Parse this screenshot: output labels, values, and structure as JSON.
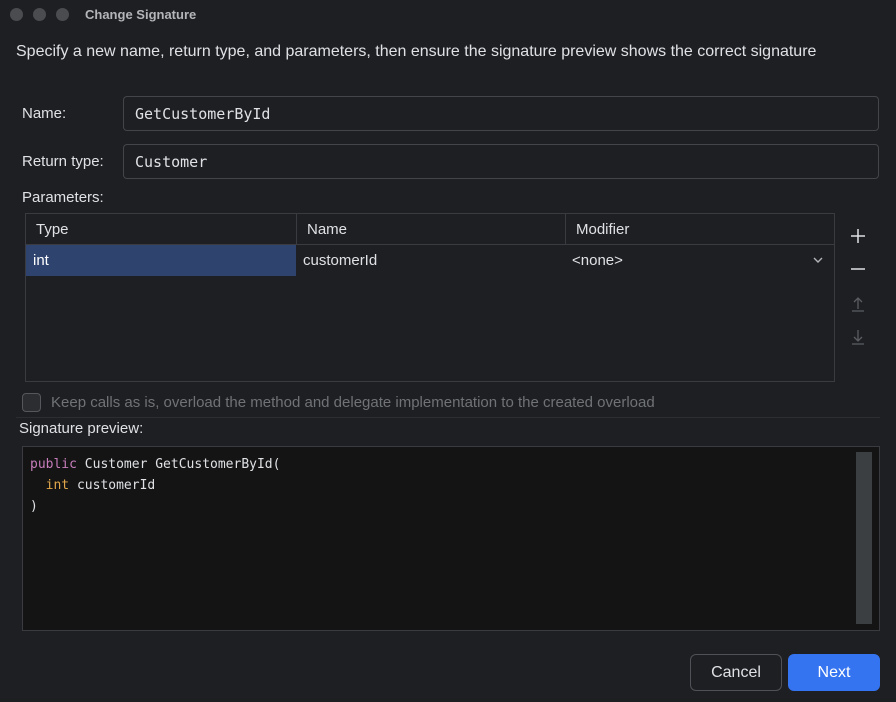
{
  "window": {
    "title": "Change Signature"
  },
  "instruction": "Specify a new name, return type, and parameters, then ensure the signature preview shows the correct signature",
  "form": {
    "name_label": "Name:",
    "name_value": "GetCustomerById",
    "return_type_label": "Return type:",
    "return_type_value": "Customer",
    "parameters_label": "Parameters:"
  },
  "parameters_table": {
    "columns": [
      "Type",
      "Name",
      "Modifier"
    ],
    "rows": [
      {
        "type": "int",
        "name": "customerId",
        "modifier": "<none>"
      }
    ]
  },
  "side_toolbar": {
    "add_icon": "plus-icon",
    "remove_icon": "minus-icon",
    "move_up_icon": "arrow-up-icon",
    "move_down_icon": "arrow-down-icon"
  },
  "overload_checkbox": {
    "label": "Keep calls as is, overload the method and delegate implementation to the created overload",
    "checked": false
  },
  "preview": {
    "label": "Signature preview:",
    "line1_keyword": "public",
    "line1_rest": " Customer GetCustomerById(",
    "line2_indent": "  ",
    "line2_type": "int",
    "line2_rest": " customerId",
    "line3": ")"
  },
  "buttons": {
    "cancel": "Cancel",
    "next": "Next"
  },
  "colors": {
    "background": "#1e1f22",
    "accent": "#3574f0",
    "selection": "#2e436e",
    "keyword": "#c77dbb",
    "type_keyword": "#e3a74b"
  }
}
